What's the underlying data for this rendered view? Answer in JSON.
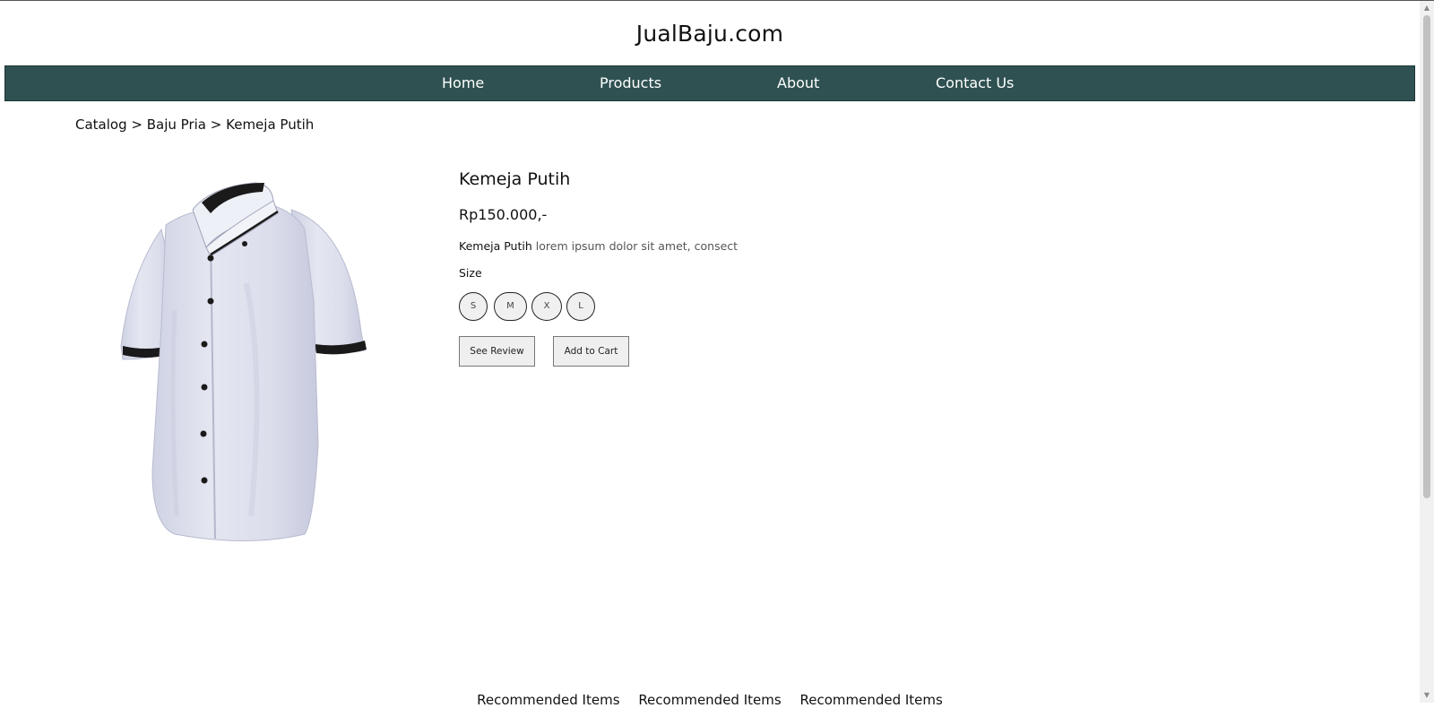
{
  "header": {
    "site_title": "JualBaju.com"
  },
  "nav": {
    "items": [
      {
        "label": "Home"
      },
      {
        "label": "Products"
      },
      {
        "label": "About"
      },
      {
        "label": "Contact Us"
      }
    ]
  },
  "breadcrumb": {
    "items": [
      "Catalog",
      "Baju Pria",
      "Kemeja Putih"
    ],
    "separator": ">"
  },
  "product": {
    "name": "Kemeja Putih",
    "price": "Rp150.000,-",
    "description_lead": "Kemeja Putih",
    "description_rest": "lorem ipsum dolor sit amet, consect",
    "size_label": "Size",
    "sizes": [
      "S",
      "M",
      "X",
      "L"
    ],
    "image_icon": "white-shirt-image"
  },
  "actions": {
    "see_review": "See Review",
    "add_to_cart": "Add to Cart"
  },
  "recommended": {
    "items": [
      "Recommended Items",
      "Recommended Items",
      "Recommended Items"
    ]
  },
  "colors": {
    "nav_bg": "#2f5151",
    "nav_text": "#ffffff",
    "shirt": "#dfe1ee",
    "shirt_trim": "#1a1a1a"
  }
}
